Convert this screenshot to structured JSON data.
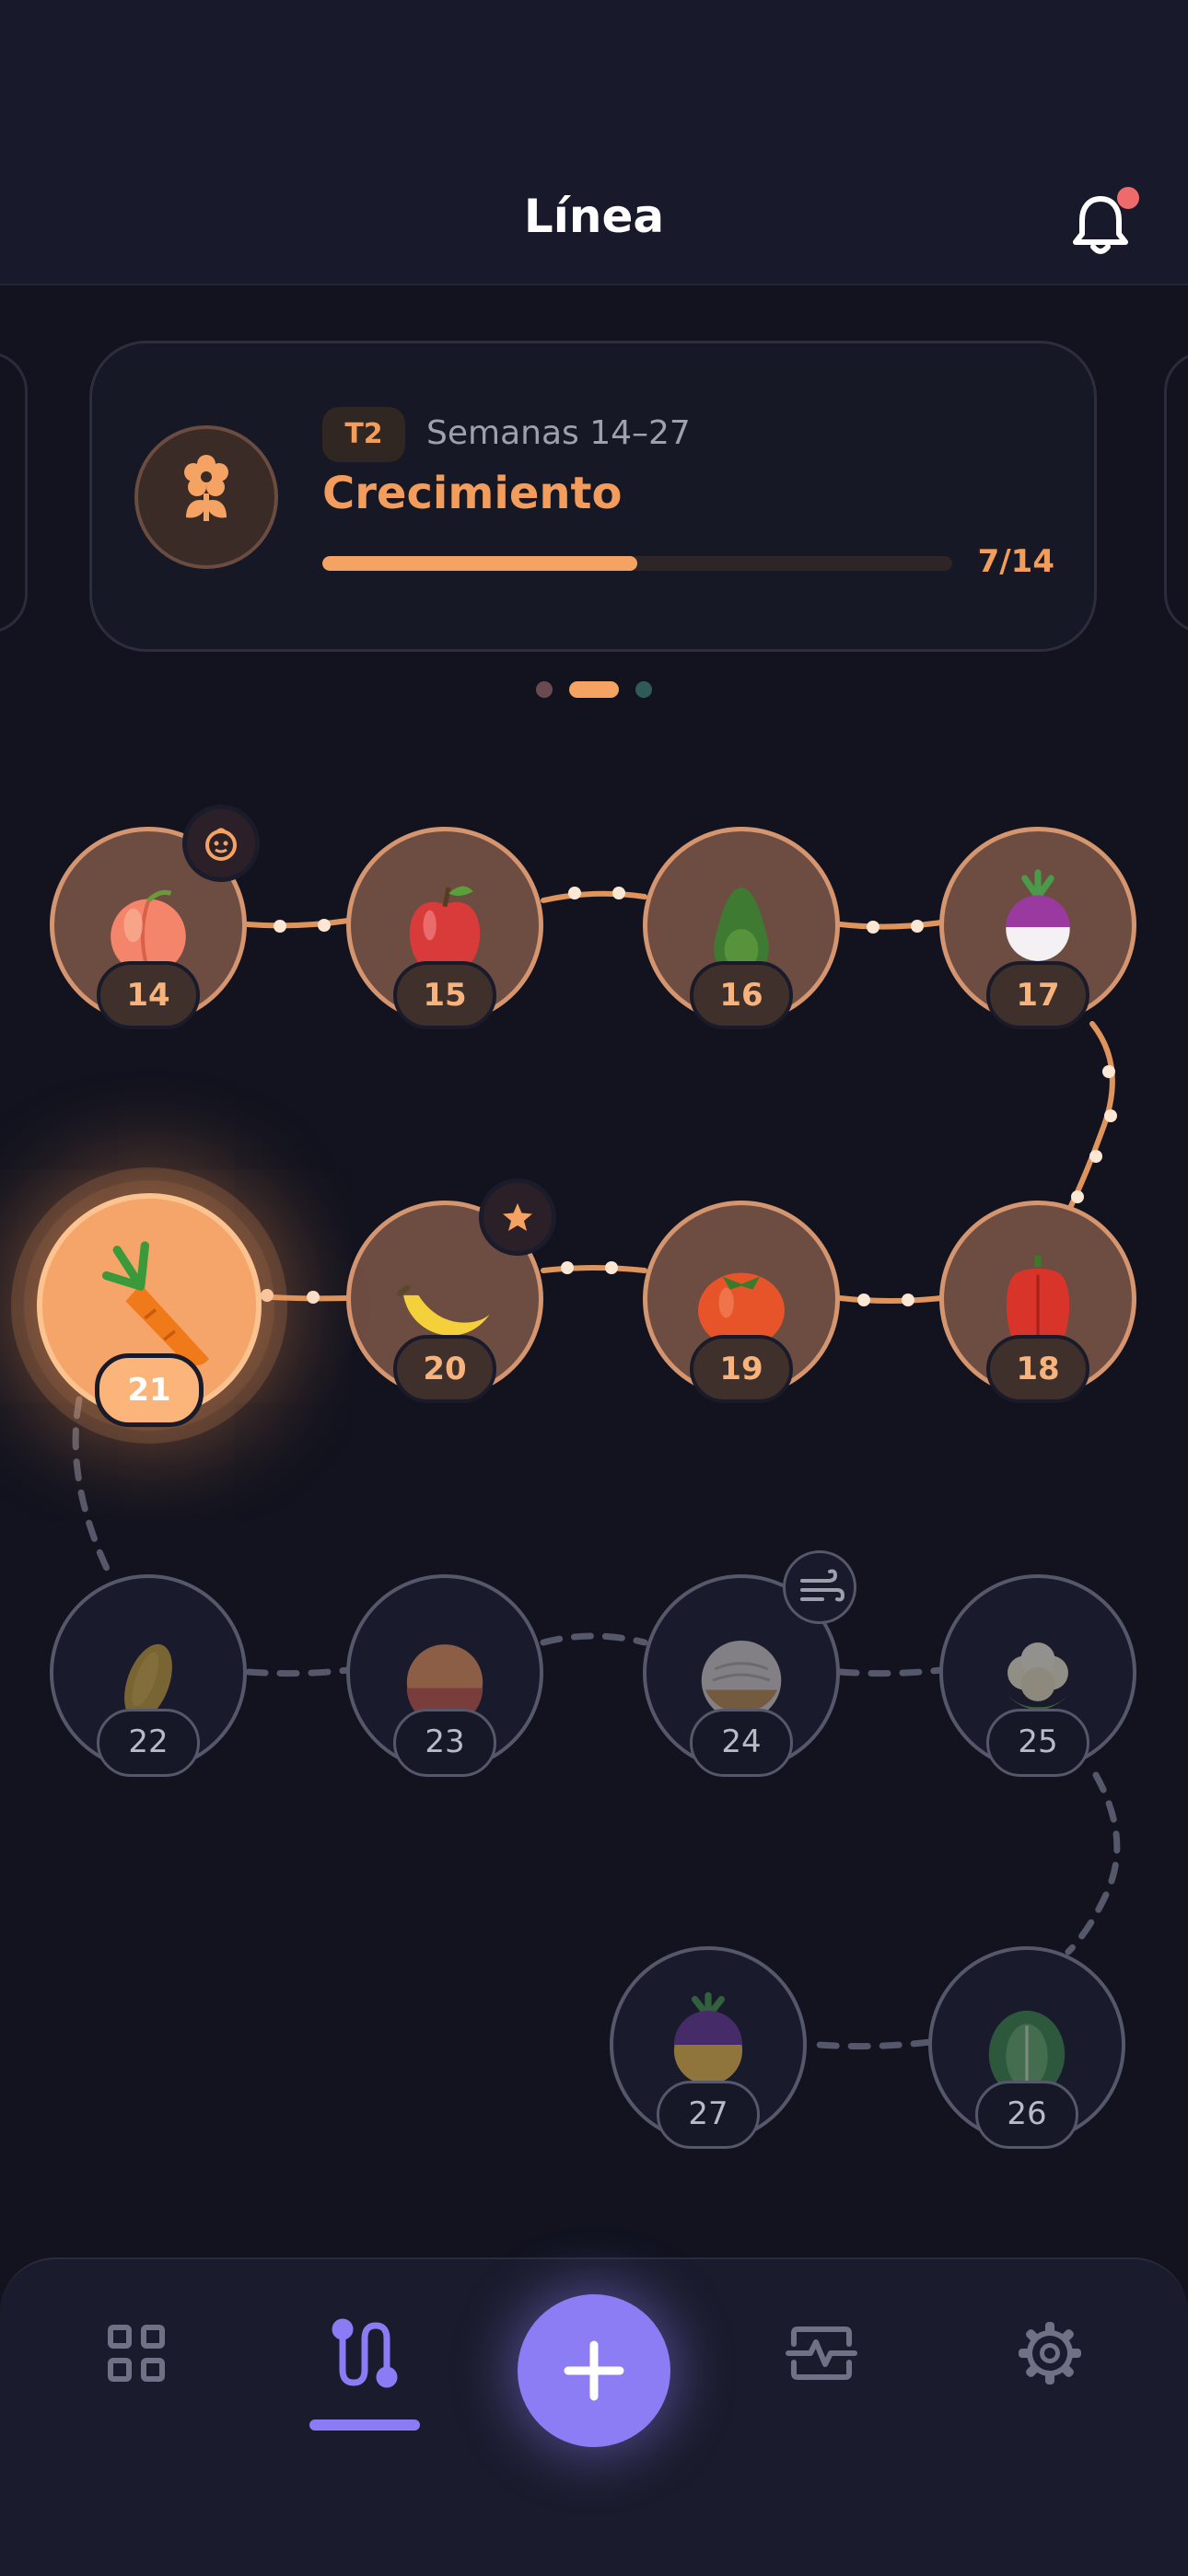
{
  "header": {
    "title": "Línea",
    "notification_icon": "bell-icon",
    "has_unread_notifications": true
  },
  "trimester_card": {
    "icon": "flower-icon",
    "badge": "T2",
    "weeks": "Semanas 14–27",
    "phase": "Crecimiento",
    "progress_current": 7,
    "progress_total": 14,
    "progress_label": "7/14",
    "progress_fraction": 0.5
  },
  "carousel": {
    "page_count": 3,
    "active_page": 2
  },
  "timeline": {
    "current_week": 21,
    "weeks": [
      {
        "week": "14",
        "status": "past",
        "fruit": "peach-icon",
        "badge": "baby-face-icon"
      },
      {
        "week": "15",
        "status": "past",
        "fruit": "apple-icon"
      },
      {
        "week": "16",
        "status": "past",
        "fruit": "avocado-icon"
      },
      {
        "week": "17",
        "status": "past",
        "fruit": "turnip-icon"
      },
      {
        "week": "18",
        "status": "past",
        "fruit": "bell-pepper-icon"
      },
      {
        "week": "19",
        "status": "past",
        "fruit": "tomato-icon"
      },
      {
        "week": "20",
        "status": "past",
        "fruit": "banana-icon",
        "badge": "star-icon"
      },
      {
        "week": "21",
        "status": "current",
        "fruit": "carrot-icon"
      },
      {
        "week": "22",
        "status": "future",
        "fruit": "papaya-icon"
      },
      {
        "week": "23",
        "status": "future",
        "fruit": "grapefruit-icon"
      },
      {
        "week": "24",
        "status": "future",
        "fruit": "melon-icon",
        "badge": "wind-icon"
      },
      {
        "week": "25",
        "status": "future",
        "fruit": "cauliflower-icon"
      },
      {
        "week": "26",
        "status": "future",
        "fruit": "lettuce-icon"
      },
      {
        "week": "27",
        "status": "future",
        "fruit": "rutabaga-icon"
      }
    ]
  },
  "bottom_nav": {
    "items": [
      {
        "icon": "grid-icon",
        "active": false
      },
      {
        "icon": "timeline-icon",
        "active": true
      },
      {
        "icon": "plus-icon",
        "active": false
      },
      {
        "icon": "activity-monitor-icon",
        "active": false
      },
      {
        "icon": "settings-gear-icon",
        "active": false
      }
    ]
  },
  "colors": {
    "background": "#12131f",
    "accent": "#f5a362",
    "nav_accent": "#8c7df5",
    "notification": "#ef6b6b"
  }
}
